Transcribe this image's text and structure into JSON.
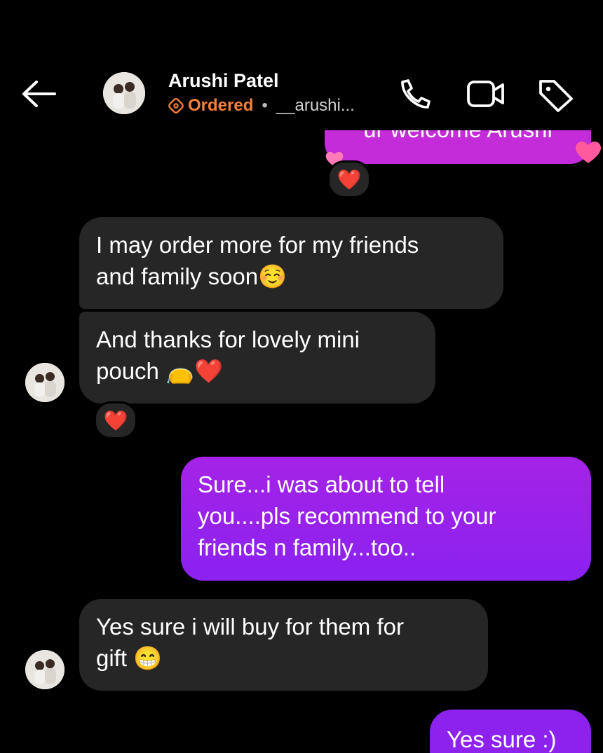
{
  "header": {
    "name": "Arushi Patel",
    "status": "Ordered",
    "separator": "•",
    "handle": "__arushi..."
  },
  "messages": [
    {
      "from": "me",
      "text": "ur welcome Arushi"
    },
    {
      "from": "them",
      "text": "I may order more for my friends and family soon☺️"
    },
    {
      "from": "them",
      "text": "And thanks for lovely mini pouch 👝❤️"
    },
    {
      "from": "me",
      "text": "Sure...i was about to tell you....pls recommend  to your friends  n family...too.."
    },
    {
      "from": "them",
      "text": "Yes sure i will buy for them for gift 😁"
    },
    {
      "from": "me",
      "text": "Yes sure :)"
    }
  ],
  "lines": {
    "m0": "ur welcome Arushi",
    "m1a": "I may order more for my friends",
    "m1b": "and family soon☺️",
    "m2a": "And thanks for lovely mini",
    "m2b": "pouch 👝❤️",
    "m3a": "Sure...i was about to tell",
    "m3b": "you....pls recommend  to your",
    "m3c": "friends  n family...too..",
    "m4a": "Yes sure i will buy for them for",
    "m4b": "gift 😁",
    "m5": "Yes sure :)"
  },
  "reactions": {
    "heart": "❤️"
  },
  "colors": {
    "background": "#000000",
    "incoming_bubble": "#262626",
    "outgoing_top": "#a523e6",
    "outgoing_bottom": "#8b21f0",
    "accent_ordered": "#f5813b",
    "first_bubble": "#c42bd9"
  },
  "icons": [
    "back-arrow-icon",
    "phone-icon",
    "video-icon",
    "tag-icon",
    "heart-icon"
  ]
}
